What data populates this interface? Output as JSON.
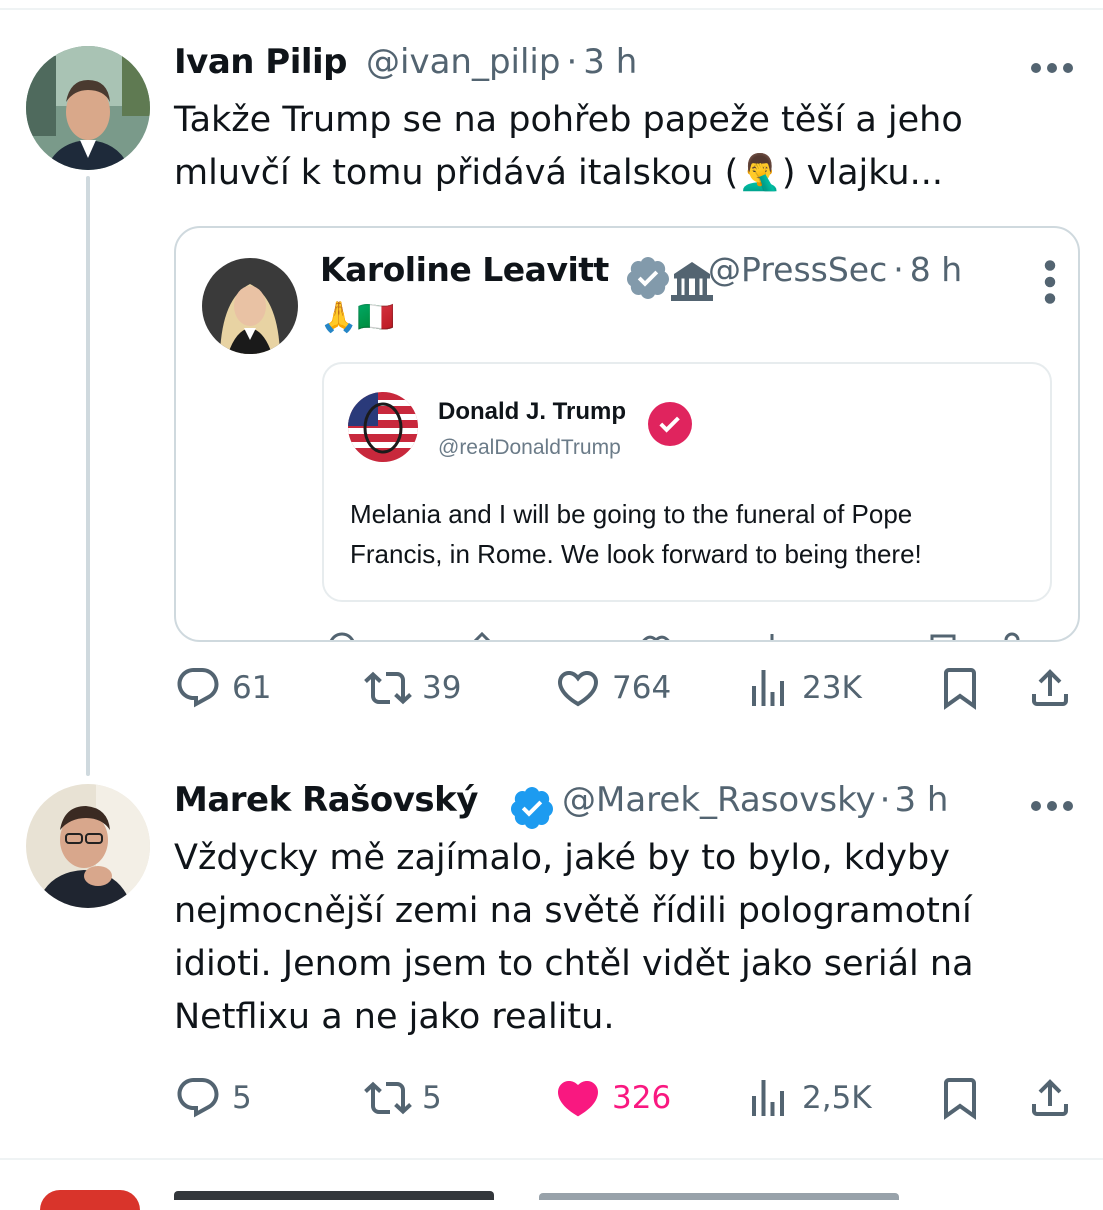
{
  "tweets": [
    {
      "name": "Ivan Pilip",
      "handle": "@ivan_pilip",
      "dot": "·",
      "time": "3 h",
      "text": "Takže Trump se na pohřeb papeže těší a jeho\nmluvčí k tomu přidává italskou (🤦‍♂️) vlajku...",
      "replies": "61",
      "retweets": "39",
      "likes": "764",
      "views": "23K",
      "liked": false
    },
    {
      "name": "Marek Rašovský",
      "handle": "@Marek_Rasovsky",
      "dot": "·",
      "time": "3 h",
      "text": "Vždycky mě zajímalo, jaké by to bylo, kdyby\nnejmocnější zemi na světě řídili pologramotní\nidioti. Jenom jsem to chtěl vidět jako seriál na\nNetflixu a ne jako realitu.",
      "replies": "5",
      "retweets": "5",
      "likes": "326",
      "views": "2,5K",
      "liked": true
    }
  ],
  "quoted": {
    "name": "Karoline Leavitt",
    "handle": "@PressSec",
    "dot": "·",
    "time": "8 h",
    "text": "🙏🇮🇹",
    "inner": {
      "name": "Donald J. Trump",
      "handle": "@realDonaldTrump",
      "text": "Melania and I will be going to the funeral of Pope\nFrancis, in Rome. We look forward to being there!"
    }
  },
  "colors": {
    "verified_blue": "#1d9bf0",
    "verified_gray": "#829aab",
    "like_pink": "#f91880",
    "muted": "#536471",
    "truth_red": "#e0245e"
  },
  "icons": [
    "reply-icon",
    "retweet-icon",
    "like-icon",
    "views-icon",
    "bookmark-icon",
    "share-icon",
    "more-icon",
    "verified-badge-icon",
    "government-building-icon"
  ]
}
